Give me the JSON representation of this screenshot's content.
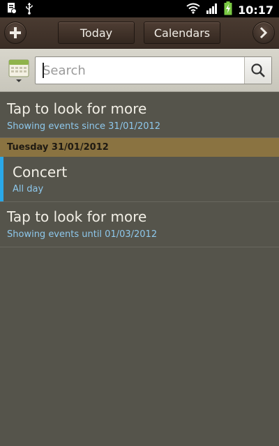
{
  "status_bar": {
    "time": "10:17",
    "icons": [
      "notification-icon",
      "usb-icon",
      "wifi-icon",
      "signal-icon",
      "battery-charging-icon"
    ]
  },
  "toolbar": {
    "today_label": "Today",
    "calendars_label": "Calendars",
    "add_icon": "plus-icon",
    "next_icon": "chevron-right-icon"
  },
  "search": {
    "placeholder": "Search",
    "value": ""
  },
  "list": {
    "load_earlier": {
      "title": "Tap to look for more",
      "subtitle": "Showing events since 31/01/2012"
    },
    "date_header": "Tuesday 31/01/2012",
    "event": {
      "title": "Concert",
      "time": "All day",
      "color": "#2aa8e8"
    },
    "load_later": {
      "title": "Tap to look for more",
      "subtitle": "Showing events until 01/03/2012"
    }
  },
  "colors": {
    "background": "#55544b",
    "date_header": "#8a7341",
    "subtitle": "#8ec8ec",
    "toolbar": "#3a2d25"
  }
}
